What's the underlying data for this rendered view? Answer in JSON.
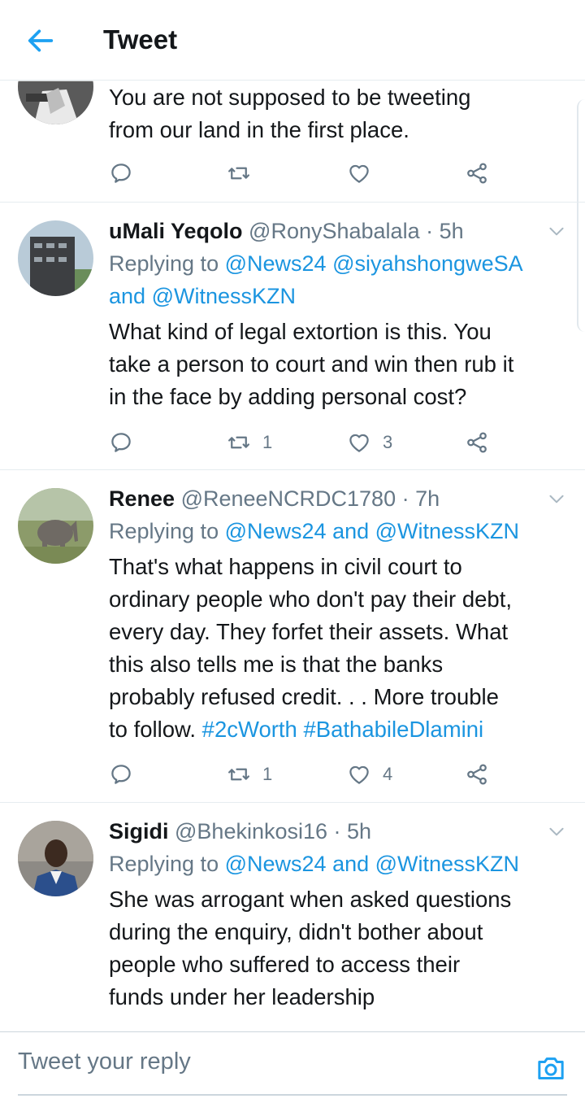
{
  "header": {
    "title": "Tweet"
  },
  "tweets": [
    {
      "text_lines": [
        "You are not supposed to be tweeting",
        "from our land in the first place."
      ],
      "actions": {
        "retweets": "",
        "likes": ""
      }
    },
    {
      "name": "uMali Yeqolo",
      "handle": "@RonyShabalala",
      "time": "· 5h",
      "replying_prefix": "Replying to",
      "replying_line1": "@News24 @siyahshongweSA",
      "replying_line2_and": "and",
      "replying_line2_link": "@WitnessKZN",
      "text_lines": [
        "What kind of legal extortion is this. You",
        "take a person to court and win then rub it",
        "in the face by adding personal cost?"
      ],
      "actions": {
        "retweets": "1",
        "likes": "3"
      }
    },
    {
      "name": "Renee",
      "handle": "@ReneeNCRDC1780",
      "time": "· 7h",
      "replying_prefix": "Replying to",
      "replying_line1": "@News24 and @WitnessKZN",
      "text_lines": [
        "That's what happens in civil court to",
        "ordinary people who don't pay their debt,",
        "every day. They forfet their assets. What",
        "this also tells me is that the banks",
        "probably refused credit. . . More trouble"
      ],
      "last_line_prefix": "to follow.",
      "hashtags": "#2cWorth #BathabileDlamini",
      "actions": {
        "retweets": "1",
        "likes": "4"
      }
    },
    {
      "name": "Sigidi",
      "handle": "@Bhekinkosi16",
      "time": "· 5h",
      "replying_prefix": "Replying to",
      "replying_line1": "@News24 and @WitnessKZN",
      "text_lines": [
        "She was arrogant when asked questions",
        "during the enquiry, didn't bother about",
        "people who suffered to access their",
        "funds under her leadership"
      ]
    }
  ],
  "compose": {
    "placeholder": "Tweet your reply"
  },
  "colors": {
    "accent": "#1b95e0",
    "secondary": "#657786",
    "border": "#e6ecf0"
  },
  "icons": [
    "back-arrow-icon",
    "reply-icon",
    "retweet-icon",
    "like-icon",
    "share-icon",
    "chevron-down-icon",
    "camera-icon"
  ]
}
